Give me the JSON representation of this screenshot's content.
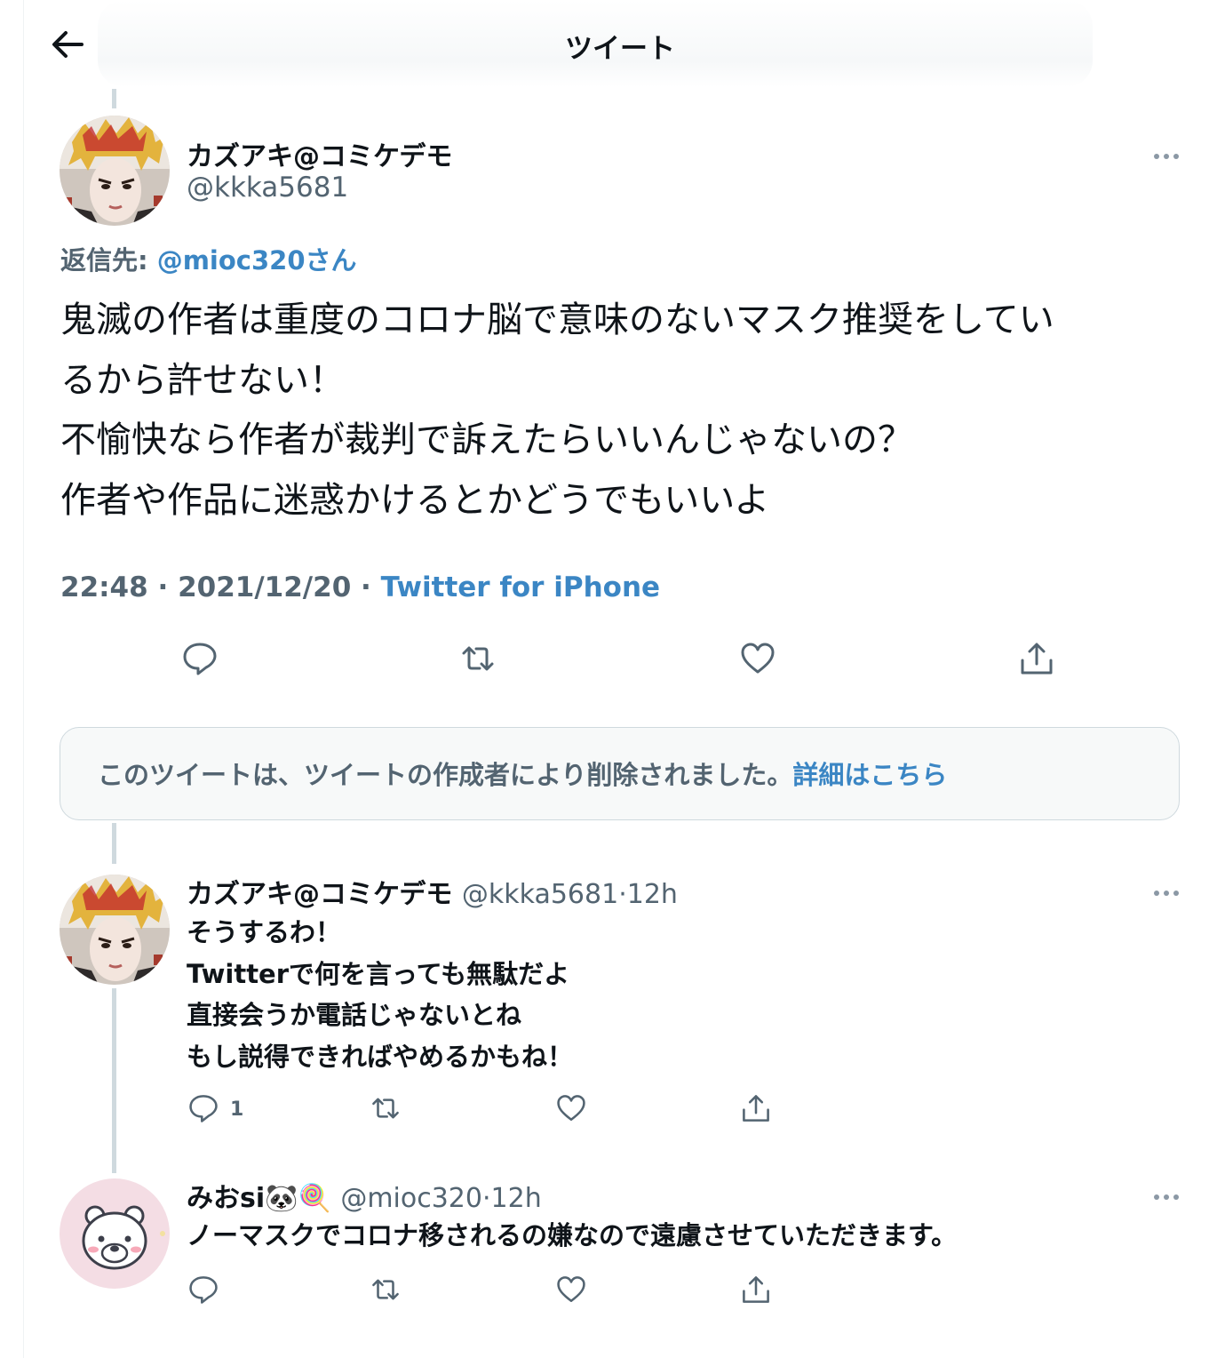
{
  "header": {
    "title": "ツイート"
  },
  "main_tweet": {
    "author_name": "カズアキ@コミケデモ",
    "author_handle": "@kkka5681",
    "reply_prefix": "返信先: ",
    "reply_to": "@mioc320さん",
    "lines": [
      "鬼滅の作者は重度のコロナ脳で意味のないマスク推奨をしてい",
      "るから許せない！",
      "不愉快なら作者が裁判で訴えたらいいんじゃないの？",
      "作者や作品に迷惑かけるとかどうでもいいよ"
    ],
    "time": "22:48",
    "date": "2021/12/20",
    "source": "Twitter for iPhone"
  },
  "deleted_notice": {
    "text": "このツイートは、ツイートの作成者により削除されました。",
    "link": "詳細はこちら"
  },
  "reply_1": {
    "author_name": "カズアキ@コミケデモ",
    "author_handle": "@kkka5681",
    "age": "12h",
    "lines": [
      "そうするわ！",
      "Twitterで何を言っても無駄だよ",
      "直接会うか電話じゃないとね",
      "もし説得できればやめるかもね！"
    ],
    "reply_count": "1"
  },
  "reply_2": {
    "author_name": "みおsi",
    "author_emojis": "🐼🍭",
    "author_handle": "@mioc320",
    "age": "12h",
    "lines": [
      "ノーマスクでコロナ移されるの嫌なので遠慮させていただきます。"
    ]
  },
  "icons": [
    "back-arrow-icon",
    "more-icon",
    "reply-icon",
    "retweet-icon",
    "like-icon",
    "share-icon"
  ],
  "colors": {
    "link": "#3b86c4",
    "muted": "#536471",
    "text": "#0f1419",
    "border": "#cfd9de"
  }
}
